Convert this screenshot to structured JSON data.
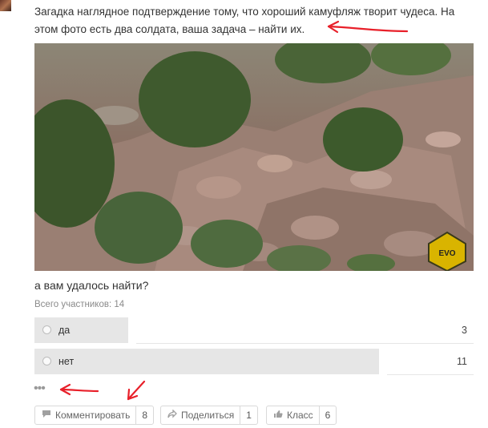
{
  "post": {
    "text": "Загадка наглядное подтверждение тому, что хороший камуфляж творит чудеса. На этом фото есть два солдата, ваша задача – найти их.",
    "photo_badge": "EVO"
  },
  "poll": {
    "question": "а вам удалось найти?",
    "participants": "Всего участников: 14",
    "options": [
      {
        "label": "да",
        "count": "3",
        "fraction": 0.214
      },
      {
        "label": "нет",
        "count": "11",
        "fraction": 0.786
      }
    ],
    "more": "•••"
  },
  "actions": {
    "comment": {
      "label": "Комментировать",
      "count": "8",
      "icon": "speech-bubble-icon"
    },
    "share": {
      "label": "Поделиться",
      "count": "1",
      "icon": "share-arrow-icon"
    },
    "like": {
      "label": "Класс",
      "count": "6",
      "icon": "thumbs-up-icon"
    }
  },
  "colors": {
    "annotation": "#e8202a",
    "bar": "#e6e6e6",
    "badge": "#d9b400"
  }
}
